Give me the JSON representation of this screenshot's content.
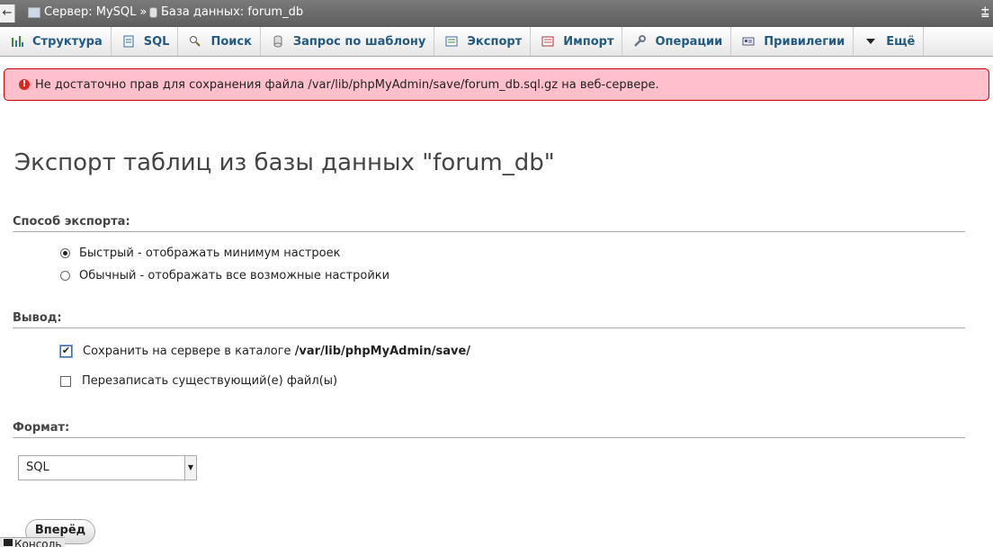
{
  "breadcrumb": {
    "back": "←",
    "server": "Сервер: MySQL",
    "separator": "»",
    "database": "База данных: forum_db",
    "collapse": "⩲"
  },
  "tabs": [
    {
      "label": "Структура",
      "icon": "structure-icon"
    },
    {
      "label": "SQL",
      "icon": "sql-icon"
    },
    {
      "label": "Поиск",
      "icon": "search-icon"
    },
    {
      "label": "Запрос по шаблону",
      "icon": "query-icon"
    },
    {
      "label": "Экспорт",
      "icon": "export-icon"
    },
    {
      "label": "Импорт",
      "icon": "import-icon"
    },
    {
      "label": "Операции",
      "icon": "wrench-icon"
    },
    {
      "label": "Привилегии",
      "icon": "privileges-icon"
    },
    {
      "label": "Ещё",
      "icon": "chevron-down-icon"
    }
  ],
  "error": {
    "text": "Не достаточно прав для сохранения файла /var/lib/phpMyAdmin/save/forum_db.sql.gz на веб-сервере.",
    "icon": "!"
  },
  "page_title": "Экспорт таблиц из базы данных \"forum_db\"",
  "export_method": {
    "heading": "Способ экспорта:",
    "options": [
      {
        "label": "Быстрый - отображать минимум настроек",
        "selected": true
      },
      {
        "label": "Обычный - отображать все возможные настройки",
        "selected": false
      }
    ]
  },
  "output": {
    "heading": "Вывод:",
    "save_label": "Сохранить на сервере в каталоге",
    "save_path": "/var/lib/phpMyAdmin/save/",
    "save_checked": true,
    "overwrite_label": "Перезаписать существующий(е) файл(ы)",
    "overwrite_checked": false
  },
  "format": {
    "heading": "Формат:",
    "selected": "SQL",
    "arrow": "▼"
  },
  "go_button": "Вперёд",
  "console": "Консоль",
  "colors": {
    "tab_text": "#235a81",
    "error_bg": "#ffc0cb",
    "error_border": "#cc0000"
  }
}
